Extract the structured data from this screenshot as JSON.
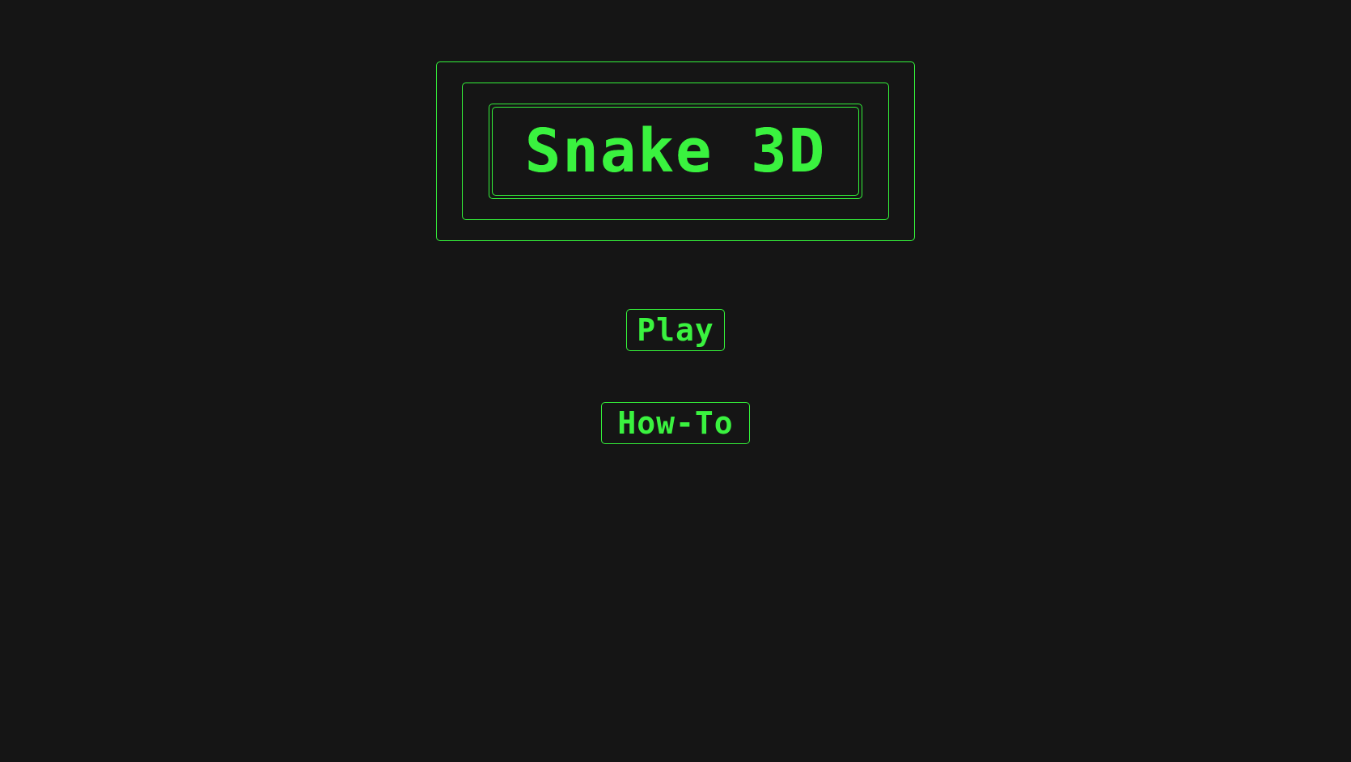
{
  "title": "Snake 3D",
  "menu": {
    "play_label": "Play",
    "howto_label": "How-To"
  },
  "colors": {
    "background": "#151515",
    "accent": "#3af23f"
  }
}
